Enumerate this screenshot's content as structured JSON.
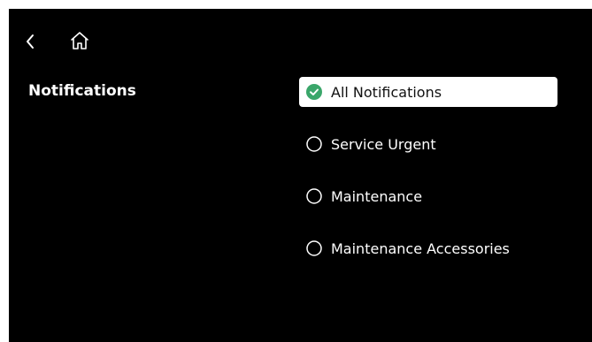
{
  "header": {
    "back_icon": "chevron-left-icon",
    "home_icon": "home-icon"
  },
  "section": {
    "title": "Notifications"
  },
  "options": [
    {
      "label": "All Notifications",
      "selected": true
    },
    {
      "label": "Service Urgent",
      "selected": false
    },
    {
      "label": "Maintenance",
      "selected": false
    },
    {
      "label": "Maintenance Accessories",
      "selected": false
    }
  ],
  "colors": {
    "background": "#000000",
    "text": "#ffffff",
    "selected_bg": "#ffffff",
    "selected_text": "#111111",
    "check_green": "#3aa66a"
  }
}
